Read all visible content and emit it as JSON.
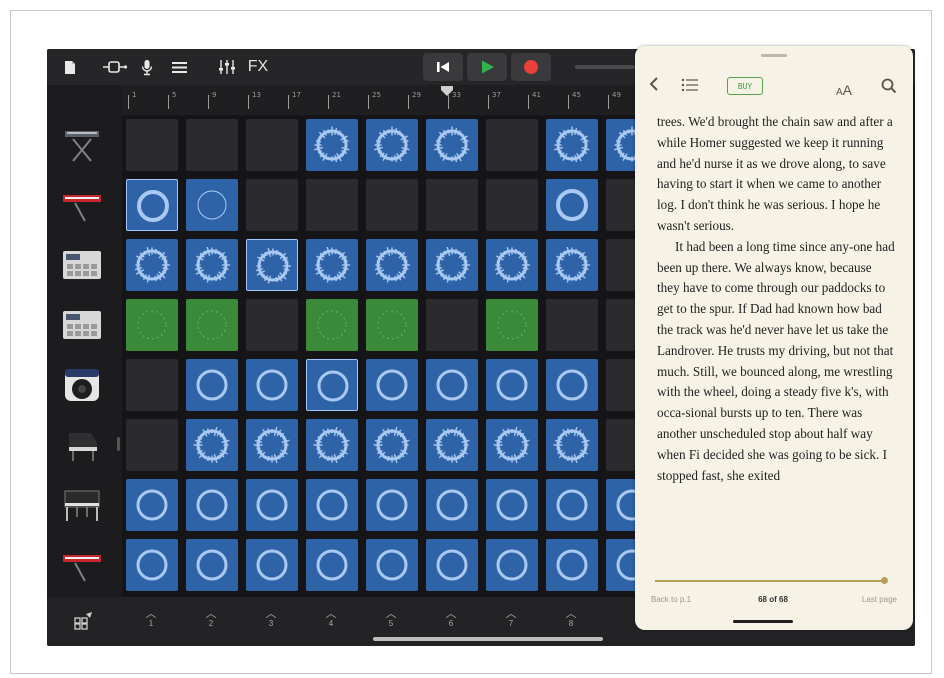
{
  "toolbar": {
    "fx_label": "FX",
    "icons": [
      "document-icon",
      "input-icon",
      "microphone-icon",
      "tracks-icon",
      "mixer-icon",
      "rewind-icon",
      "play-icon",
      "record-icon"
    ],
    "colors": {
      "play": "#2fb34a",
      "record": "#e8413a"
    }
  },
  "ruler": {
    "labels": [
      "1",
      "5",
      "9",
      "13",
      "17",
      "21",
      "25",
      "29",
      "33",
      "37",
      "41",
      "45",
      "49"
    ]
  },
  "grid": {
    "rows": [
      [
        "empty",
        "empty",
        "empty",
        "blue",
        "blue",
        "blue",
        "empty",
        "blue",
        "blue"
      ],
      [
        "blue",
        "blue",
        "empty",
        "empty",
        "empty",
        "empty",
        "empty",
        "blue",
        "empty"
      ],
      [
        "blue",
        "blue",
        "blue",
        "blue",
        "blue",
        "blue",
        "blue",
        "blue",
        "empty"
      ],
      [
        "green",
        "green",
        "empty",
        "green",
        "green",
        "empty",
        "green",
        "empty",
        "empty"
      ],
      [
        "empty",
        "blue",
        "blue",
        "blue",
        "blue",
        "blue",
        "blue",
        "blue",
        "empty"
      ],
      [
        "empty",
        "blue",
        "blue",
        "blue",
        "blue",
        "blue",
        "blue",
        "blue",
        "empty"
      ],
      [
        "blue",
        "blue",
        "blue",
        "blue",
        "blue",
        "blue",
        "blue",
        "blue",
        "blue"
      ],
      [
        "blue",
        "blue",
        "blue",
        "blue",
        "blue",
        "blue",
        "blue",
        "blue",
        "blue"
      ]
    ],
    "colors": {
      "blue": "#2f63a8",
      "green": "#3a8a3a",
      "empty": "#2b2b2d"
    }
  },
  "instruments": [
    "keyboard-stand-icon",
    "red-synth-icon",
    "drum-machine-icon",
    "drum-machine-icon",
    "amp-icon",
    "piano-icon",
    "upright-piano-icon",
    "red-synth-icon"
  ],
  "bottom": {
    "triggers": [
      "1",
      "2",
      "3",
      "4",
      "5",
      "6",
      "7",
      "8"
    ]
  },
  "book": {
    "buy_label": "BUY",
    "aa_label_small": "A",
    "aa_label_large": "A",
    "paragraphs": [
      "trees. We'd brought the chain saw and after a while Homer suggested we keep it running and he'd nurse it as we drove along, to save having to start it when we came to another log. I don't think he was serious. I hope he wasn't serious.",
      "It had been a long time since any-one had been up there. We always know, because they have to come through our paddocks to get to the spur. If Dad had known how bad the track was he'd never have let us take the Landrover. He trusts my driving, but not that much. Still, we bounced along, me wrestling with the wheel, doing a steady five k's, with occa-sional bursts up to ten. There was another unscheduled stop about half way when Fi decided she was going to be sick. I stopped fast, she exited"
    ],
    "progress": 0.99,
    "footer": {
      "left": "Back to p.1",
      "middle": "68 of 68",
      "right": "Last page"
    }
  }
}
